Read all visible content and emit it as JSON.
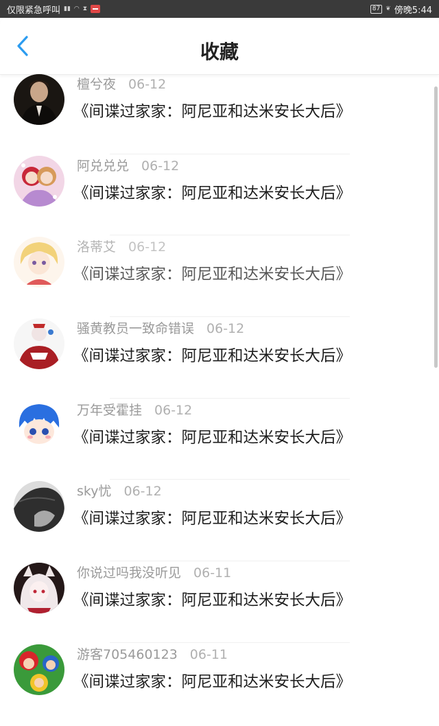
{
  "status_bar": {
    "left_text": "仅限紧急呼叫",
    "battery": "87",
    "right_text": "傍晚5:44"
  },
  "nav": {
    "title": "收藏",
    "back_icon": "chevron-left-icon",
    "accent": "#2c9cf0"
  },
  "items": [
    {
      "user": "檀兮夜",
      "date": "06-12",
      "book": "《间谍过家家：阿尼亚和达米安长大后》"
    },
    {
      "user": "阿兑兑兑",
      "date": "06-12",
      "book": "《间谍过家家：阿尼亚和达米安长大后》"
    },
    {
      "user": "洛蒂艾",
      "date": "06-12",
      "book": "《间谍过家家：阿尼亚和达米安长大后》"
    },
    {
      "user": "骚黄教员一致命错误",
      "date": "06-12",
      "book": "《间谍过家家：阿尼亚和达米安长大后》"
    },
    {
      "user": "万年受霍挂",
      "date": "06-12",
      "book": "《间谍过家家：阿尼亚和达米安长大后》"
    },
    {
      "user": "sky忧",
      "date": "06-12",
      "book": "《间谍过家家：阿尼亚和达米安长大后》"
    },
    {
      "user": "你说过吗我没听见",
      "date": "06-11",
      "book": "《间谍过家家：阿尼亚和达米安长大后》"
    },
    {
      "user": "游客705460123",
      "date": "06-11",
      "book": "《间谍过家家：阿尼亚和达米安长大后》"
    }
  ]
}
